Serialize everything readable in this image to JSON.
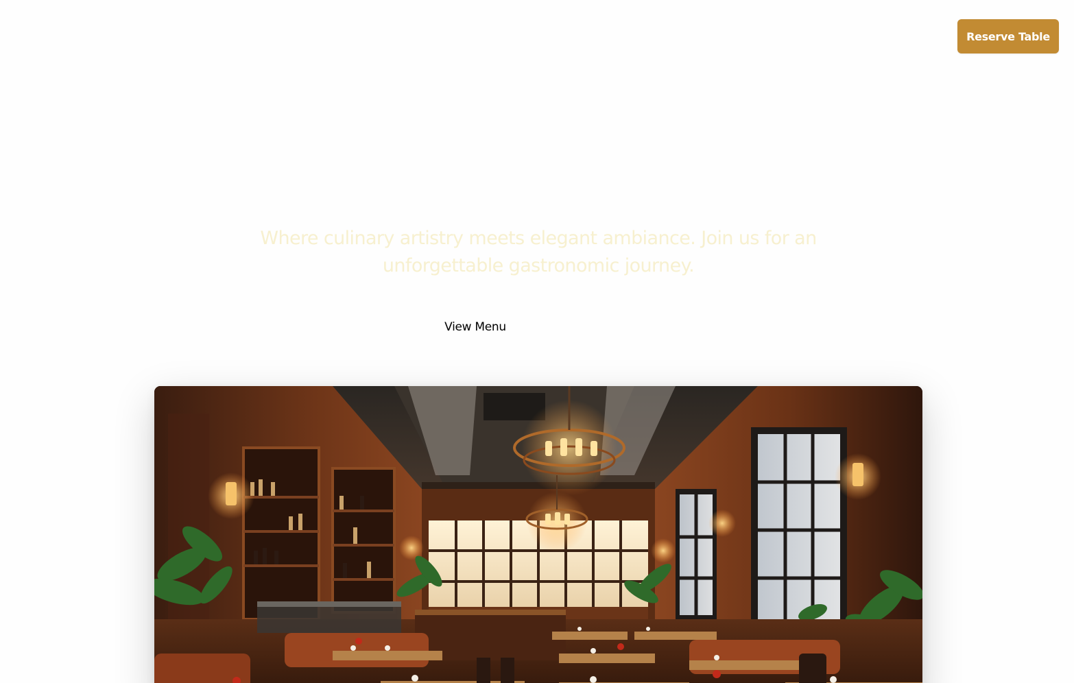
{
  "header": {
    "reserve_label": "Reserve Table"
  },
  "hero": {
    "tagline": "Where culinary artistry meets elegant ambiance. Join us for an unforgettable gastronomic journey.",
    "view_menu_label": "View Menu"
  },
  "colors": {
    "accent": "#c28b33",
    "tagline_text": "#f7f0cf",
    "page_background": "#fefefe"
  }
}
